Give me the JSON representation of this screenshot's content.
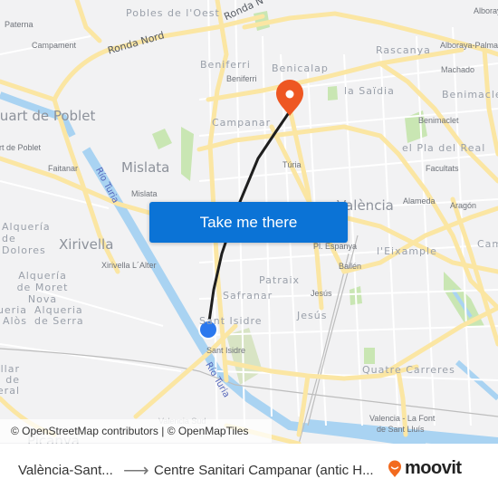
{
  "map": {
    "labels": {
      "pobles_oest": "Pobles de l'Oest",
      "ronda_nord": "Ronda Nord",
      "ronda_partial": "Ronda N",
      "paterna": "Paterna",
      "campament": "Campament",
      "beniferri_district": "Beniferri",
      "beniferri_stop": "Beniferri",
      "benicalap": "Benicalap",
      "rascanya": "Rascanya",
      "alboraya_peris": "Alboraya-Peris Arnal",
      "alboraya_palmaret": "Alboraya-Palmaret",
      "machado": "Machado",
      "benimaclet_district": "Benimaclet",
      "benimaclet_stop": "Benimaclet",
      "la_saidia": "la Saïdia",
      "campanar": "Campanar",
      "quart_de_poblet": "Quart de Poblet",
      "quart_de_poblet_stop": "Quart de Poblet",
      "faitanar": "Faitanar",
      "mislata_district": "Mislata",
      "mislata_stop": "Mislata",
      "turia": "Túria",
      "el_pla_del_real": "el Pla del Real",
      "facultats": "Facultats",
      "alameda": "Alameda",
      "aragon": "Aragón",
      "valencia": "València",
      "camins": "Camins al Grau",
      "alqueria_dolores": "Alquería de Dolores",
      "xirivella": "Xirivella",
      "xirivella_alter": "Xirivella L´Alter",
      "alqueria_moret": "Alquería de Moret Nova",
      "pl_espanya": "Pl. Espanya",
      "eixample": "l'Eixample",
      "bailen": "Bailén",
      "patraix": "Patraix",
      "safranar": "Safranar",
      "jesus_stop": "Jesús",
      "jesus_district": "Jesús",
      "alqueria_alos": "Alqueria de Alòs",
      "alqueria_serra": "Alqueria de Serra",
      "sant_isidre_district": "Sant Isidre",
      "sant_isidre_stop": "Sant Isidre",
      "rio_turia_upper": "Río Turia",
      "rio_turia_lower": "Río Turia",
      "castellar": "Castellar de l'Oliveral",
      "quatre_carreres": "Quatre Carreres",
      "valencia_font": "Valencia - La Font",
      "de_sant_lluis": "de Sant Lluís",
      "valencia_sud": "Valencia Sud",
      "picanya": "Picanya"
    },
    "colors": {
      "background": "#f2f2f3",
      "major_road": "#fbe6a3",
      "minor_road": "#ffffff",
      "water": "#a9d3f2",
      "park": "#c9e6b3",
      "route_line": "#1e1e1e",
      "origin_marker": "#2b78ee",
      "destination_marker": "#ee5722"
    }
  },
  "cta": {
    "label": "Take me there"
  },
  "attribution": "© OpenStreetMap contributors | © OpenMapTiles",
  "footer": {
    "origin": "València-Sant...",
    "arrow": "⟶",
    "destination": "Centre Sanitari Campanar (antic H...",
    "brand": "moovit",
    "brand_color": "#f26a1e"
  }
}
